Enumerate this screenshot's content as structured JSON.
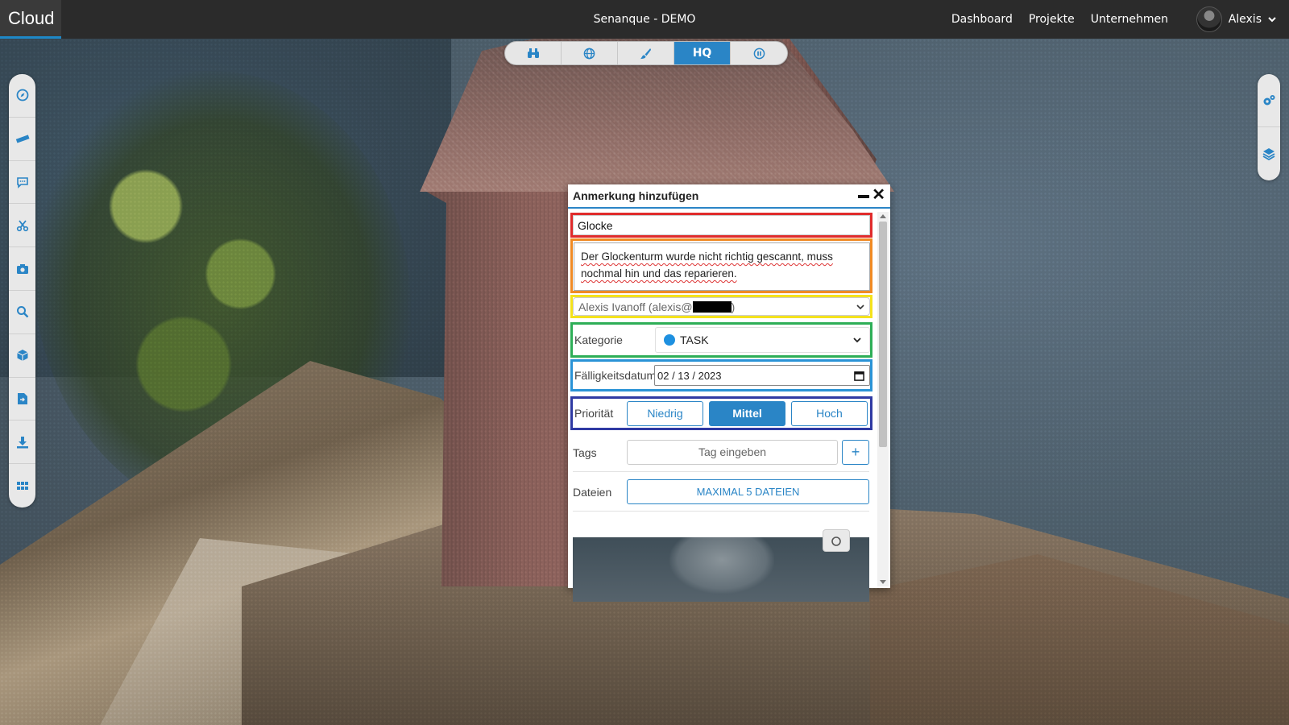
{
  "app": {
    "brand": "Cloud",
    "project_title": "Senanque - DEMO",
    "nav": [
      "Dashboard",
      "Projekte",
      "Unternehmen"
    ],
    "user_name": "Alexis"
  },
  "toolbar": {
    "buttons": [
      "binoculars-icon",
      "globe-icon",
      "brush-icon",
      "HQ",
      "pause-icon"
    ],
    "hq_label": "HQ",
    "active": "HQ"
  },
  "left_sidebar": {
    "icons": [
      "compass-icon",
      "ruler-icon",
      "comment-icon",
      "scissors-icon",
      "camera-icon",
      "search-icon",
      "cube-icon",
      "file-export-icon",
      "download-icon",
      "grid-icon"
    ]
  },
  "right_sidebar": {
    "icons": [
      "settings-icon",
      "layers-icon"
    ]
  },
  "dialog": {
    "title": "Anmerkung hinzufügen",
    "name_value": "Glocke",
    "description": "Der Glockenturm wurde nicht richtig gescannt, muss nochmal hin und das reparieren.",
    "assignee_prefix": "Alexis Ivanoff (alexis@",
    "assignee_suffix": ")",
    "category_label": "Kategorie",
    "category_value": "TASK",
    "category_color": "#1e90e0",
    "due_label": "Fälligkeitsdatum",
    "due_value": "02 / 13 / 2023",
    "priority_label": "Priorität",
    "priorities": [
      "Niedrig",
      "Mittel",
      "Hoch"
    ],
    "priority_selected": "Mittel",
    "tags_label": "Tags",
    "tags_placeholder": "Tag eingeben",
    "tags_add": "+",
    "files_label": "Dateien",
    "files_button": "MAXIMAL 5 DATEIEN"
  },
  "colors": {
    "accent": "#2a85c6",
    "topbar": "#2b2b2b",
    "frame_title": "#e02b2b",
    "frame_description": "#f08a24",
    "frame_assignee": "#f4e21c",
    "frame_category": "#2eae57",
    "frame_due": "#2a93d6",
    "frame_priority": "#2f3aa3"
  }
}
